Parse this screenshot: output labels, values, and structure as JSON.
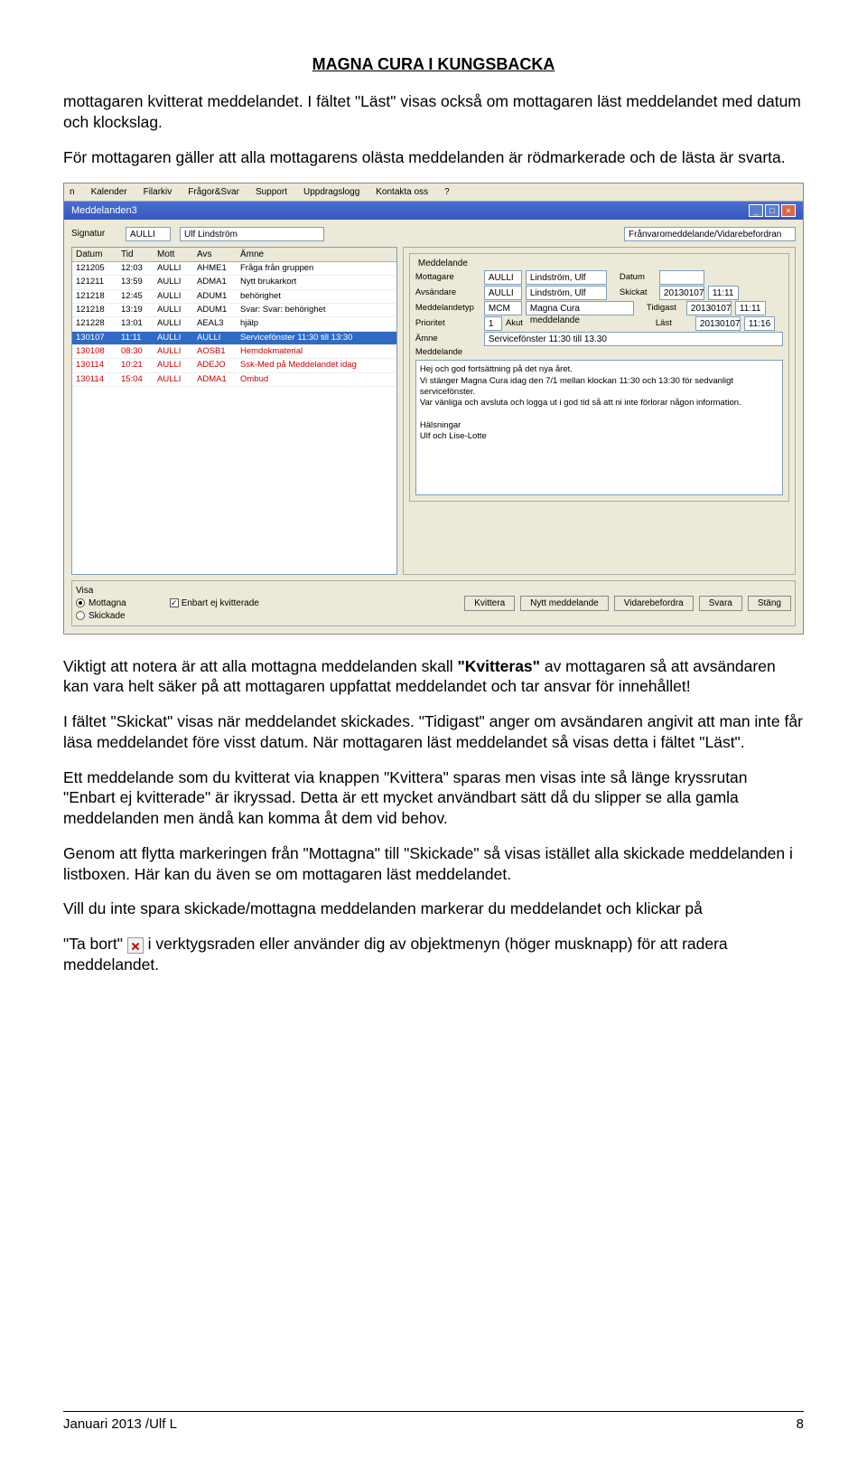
{
  "doc": {
    "header": "MAGNA CURA I KUNGSBACKA",
    "p1": "mottagaren kvitterat meddelandet.  I fältet \"Läst\" visas också om mottagaren läst meddelandet med datum och klockslag.",
    "p2": "För mottagaren gäller att alla mottagarens olästa meddelanden är rödmarkerade och de lästa är svarta.",
    "p3a": "Viktigt att notera är att alla mottagna meddelanden skall ",
    "p3b": "\"Kvitteras\"",
    "p3c": " av mottagaren så att avsändaren kan vara helt säker på att mottagaren uppfattat meddelandet och tar ansvar för innehållet!",
    "p4": "I fältet \"Skickat\" visas när meddelandet skickades. \"Tidigast\" anger om avsändaren angivit att man inte får läsa meddelandet före visst datum. När mottagaren läst meddelandet så visas detta i fältet \"Läst\".",
    "p5": "Ett meddelande som du kvitterat via knappen \"Kvittera\" sparas men visas inte så länge kryssrutan \"Enbart ej kvitterade\" är ikryssad. Detta är ett mycket användbart sätt då du slipper se alla gamla meddelanden men ändå kan komma åt dem vid behov.",
    "p6": "Genom att flytta markeringen från \"Mottagna\" till \"Skickade\" så visas istället alla skickade meddelanden i listboxen. Här kan du även se om mottagaren läst meddelandet.",
    "p7a": "Vill du inte spara skickade/mottagna meddelanden markerar du meddelandet och klickar på",
    "p7b": "\"Ta bort\" ",
    "p7c": " i verktygsraden eller använder dig av objektmenyn (höger musknapp) för att radera meddelandet.",
    "footer_left": "Januari 2013 /Ulf L",
    "footer_right": "8"
  },
  "app": {
    "menu": [
      "n",
      "Kalender",
      "Filarkiv",
      "Frågor&Svar",
      "Support",
      "Uppdragslogg",
      "Kontakta oss",
      "?"
    ],
    "window_title": "Meddelanden3",
    "signatur_label": "Signatur",
    "signatur_code": "AULLI",
    "signatur_name": "Ulf Lindström",
    "franvaro": "Frånvaromeddelande/Vidarebefordran",
    "list_headers": [
      "Datum",
      "Tid",
      "Mott",
      "Avs",
      "Ämne"
    ],
    "rows": [
      {
        "d": "121205",
        "t": "12:03",
        "m": "AULLI",
        "a": "AHME1",
        "s": "Fråga från gruppen",
        "cls": ""
      },
      {
        "d": "121211",
        "t": "13:59",
        "m": "AULLI",
        "a": "ADMA1",
        "s": "Nytt brukarkort",
        "cls": ""
      },
      {
        "d": "121218",
        "t": "12:45",
        "m": "AULLI",
        "a": "ADUM1",
        "s": "behörighet",
        "cls": ""
      },
      {
        "d": "121218",
        "t": "13:19",
        "m": "AULLI",
        "a": "ADUM1",
        "s": "Svar: Svar: behörighet",
        "cls": ""
      },
      {
        "d": "121228",
        "t": "13:01",
        "m": "AULLI",
        "a": "AEAL3",
        "s": "hjälp",
        "cls": ""
      },
      {
        "d": "130107",
        "t": "11:11",
        "m": "AULLI",
        "a": "AULLI",
        "s": "Servicefönster 11:30 till 13:30",
        "cls": "sel"
      },
      {
        "d": "130108",
        "t": "08:30",
        "m": "AULLI",
        "a": "AOSB1",
        "s": "Hemdokmaterial",
        "cls": "red"
      },
      {
        "d": "130114",
        "t": "10:21",
        "m": "AULLI",
        "a": "ADEJO",
        "s": "Ssk-Med på Meddelandet idag",
        "cls": "red"
      },
      {
        "d": "130114",
        "t": "15:04",
        "m": "AULLI",
        "a": "ADMA1",
        "s": "Ombud",
        "cls": "red"
      }
    ],
    "detail": {
      "box_title": "Meddelande",
      "mottagare_lbl": "Mottagare",
      "mottagare_code": "AULLI",
      "mottagare_name": "Lindström, Ulf",
      "datum_lbl": "Datum",
      "avsandare_lbl": "Avsändare",
      "avsandare_code": "AULLI",
      "avsandare_name": "Lindström, Ulf",
      "skickat_lbl": "Skickat",
      "skickat_d": "20130107",
      "skickat_t": "11:11",
      "medtyp_lbl": "Meddelandetyp",
      "medtyp_code": "MCM",
      "medtyp_name": "Magna Cura meddelande",
      "tidigast_lbl": "Tidigast",
      "tidigast_d": "20130107",
      "tidigast_t": "11:11",
      "prioritet_lbl": "Prioritet",
      "prioritet_val": "1",
      "akut": "Akut",
      "last_lbl": "Läst",
      "last_d": "20130107",
      "last_t": "11:16",
      "amne_lbl": "Ämne",
      "amne_val": "Servicefönster 11:30 till 13.30",
      "msg_lbl": "Meddelande",
      "msg_body": "Hej och god fortsättning på det nya året.\nVi stänger Magna Cura idag den 7/1 mellan klockan 11:30 och 13:30 för sedvanligt servicefönster.\nVar vänliga och avsluta och logga ut i god tid så att ni inte förlorar någon information.\n\nHälsningar\nUlf och Lise-Lotte"
    },
    "visa_label": "Visa",
    "radio_mottagna": "Mottagna",
    "radio_skickade": "Skickade",
    "chk_enbart": "Enbart ej kvitterade",
    "btns": [
      "Kvittera",
      "Nytt meddelande",
      "Vidarebefordra",
      "Svara",
      "Stäng"
    ]
  }
}
